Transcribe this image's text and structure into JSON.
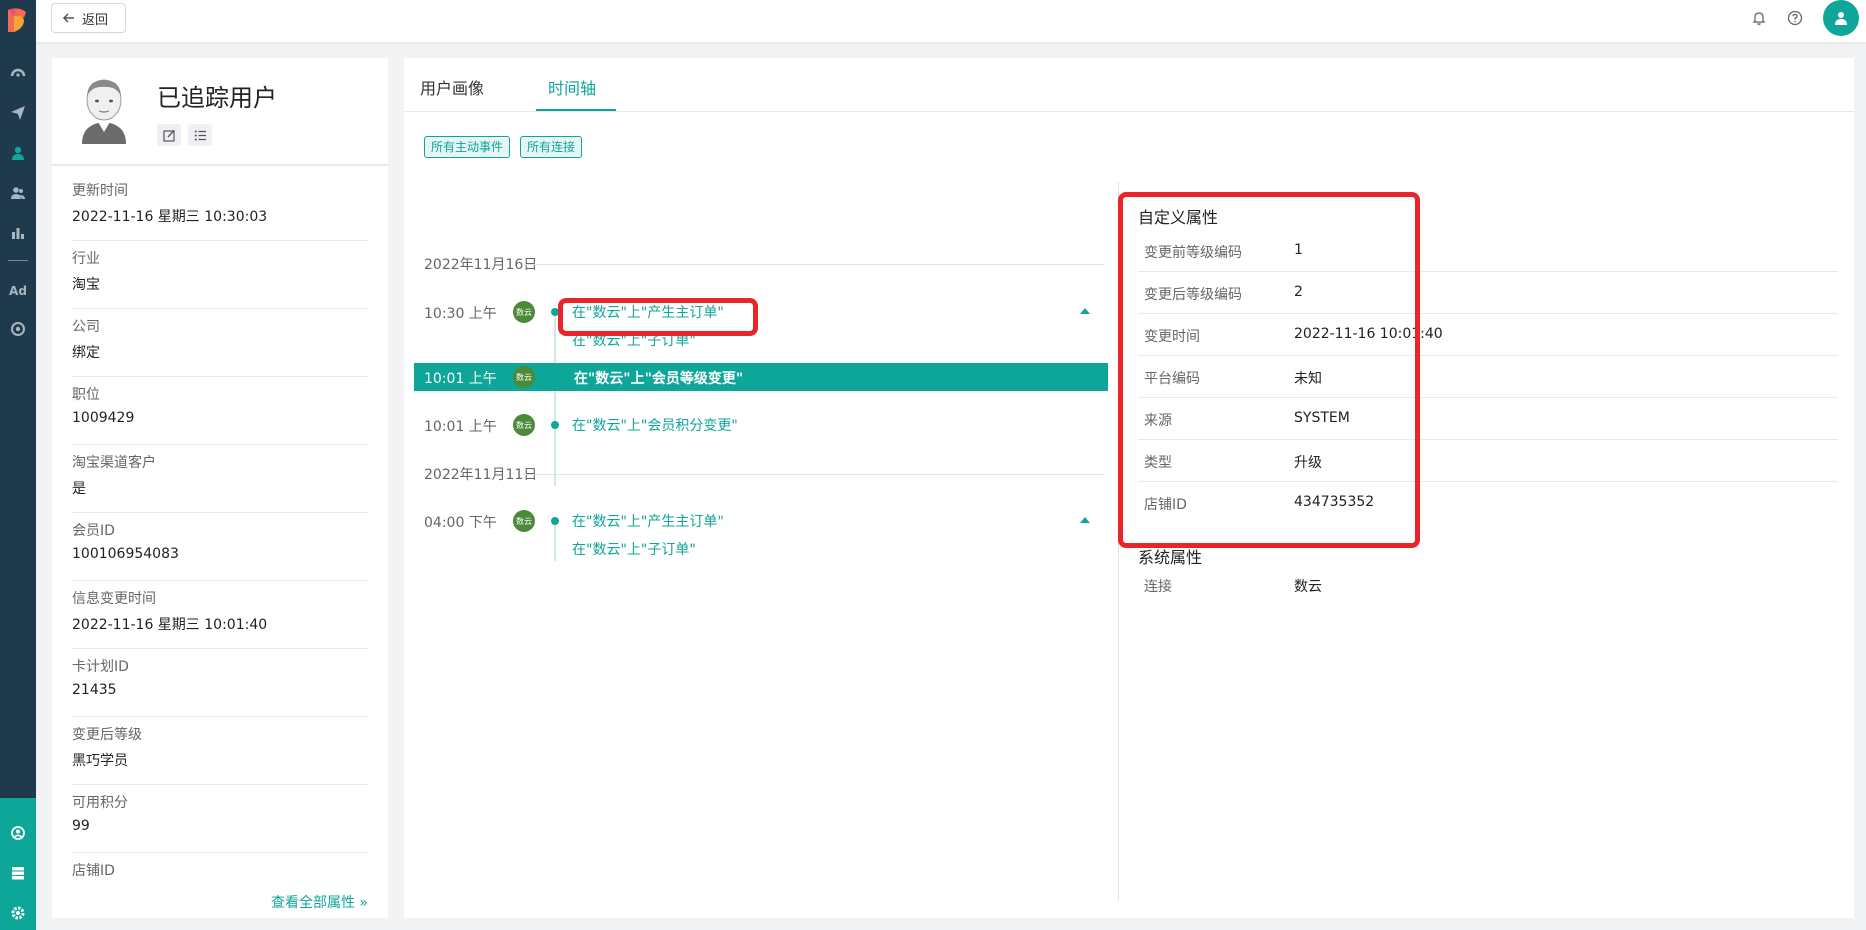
{
  "nav": {
    "top_icons": [
      "logo-icon",
      "dashboard-icon",
      "send-icon",
      "user-icon",
      "group-icon",
      "chart-icon",
      "ad-icon",
      "target-icon"
    ],
    "ad_label": "Ad",
    "bottom_icons": [
      "contacts-icon",
      "server-icon",
      "settings-icon"
    ]
  },
  "topbar": {
    "back_label": "返回"
  },
  "profile": {
    "name": "已追踪用户",
    "attributes": [
      {
        "key": "更新时间",
        "value": "2022-11-16 星期三 10:30:03"
      },
      {
        "key": "行业",
        "value": "淘宝"
      },
      {
        "key": "公司",
        "value": "绑定"
      },
      {
        "key": "职位",
        "value": "1009429"
      },
      {
        "key": "淘宝渠道客户",
        "value": "是"
      },
      {
        "key": "会员ID",
        "value": "100106954083"
      },
      {
        "key": "信息变更时间",
        "value": "2022-11-16 星期三 10:01:40"
      },
      {
        "key": "卡计划ID",
        "value": "21435"
      },
      {
        "key": "变更后等级",
        "value": "黑巧学员"
      },
      {
        "key": "可用积分",
        "value": "99"
      },
      {
        "key": "店铺ID",
        "value": ""
      }
    ],
    "view_all": "查看全部属性 »"
  },
  "main": {
    "tabs": [
      {
        "label": "用户画像"
      },
      {
        "label": "时间轴"
      }
    ],
    "chips": [
      "所有主动事件",
      "所有连接"
    ],
    "badge_text": "数云",
    "timeline": {
      "groups": [
        {
          "date": "2022年11月16日"
        },
        {
          "date": "2022年11月11日"
        }
      ],
      "events": [
        {
          "time": "10:30 上午",
          "lines": [
            "在\"数云\"上\"产生主订单\"",
            "在\"数云\"上\"子订单\""
          ]
        },
        {
          "time": "10:01 上午",
          "lines": [
            "在\"数云\"上\"会员等级变更\""
          ]
        },
        {
          "time": "10:01 上午",
          "lines": [
            "在\"数云\"上\"会员积分变更\""
          ]
        },
        {
          "time": "04:00 下午",
          "lines": [
            "在\"数云\"上\"产生主订单\"",
            "在\"数云\"上\"子订单\""
          ]
        }
      ]
    },
    "custom_title": "自定义属性",
    "custom_props": [
      {
        "key": "变更前等级编码",
        "value": "1"
      },
      {
        "key": "变更后等级编码",
        "value": "2"
      },
      {
        "key": "变更时间",
        "value": "2022-11-16 10:01:40"
      },
      {
        "key": "平台编码",
        "value": "未知"
      },
      {
        "key": "来源",
        "value": "SYSTEM"
      },
      {
        "key": "类型",
        "value": "升级"
      },
      {
        "key": "店铺ID",
        "value": "434735352"
      }
    ],
    "system_title": "系统属性",
    "system_props": [
      {
        "key": "连接",
        "value": "数云"
      }
    ]
  },
  "colors": {
    "accent": "#0ea698",
    "nav": "#1f3a4d",
    "highlight_box": "#e8262a"
  }
}
